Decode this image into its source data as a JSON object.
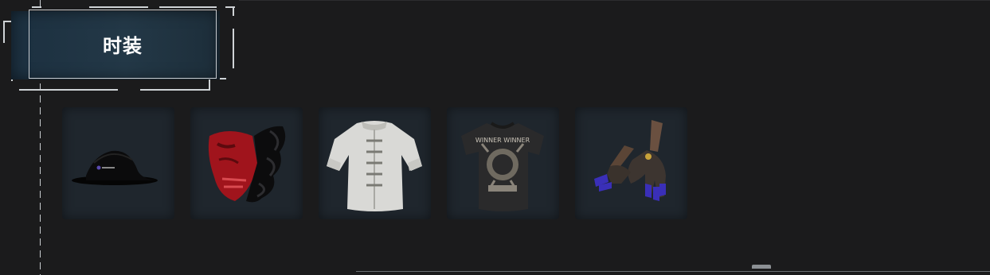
{
  "panel": {
    "title": "时装"
  },
  "items": [
    {
      "name": "hat-item",
      "icon": "hat-icon",
      "label": "hat"
    },
    {
      "name": "mask-item",
      "icon": "mask-icon",
      "label": "mask"
    },
    {
      "name": "shirt-item",
      "icon": "shirt-icon",
      "label": "shirt"
    },
    {
      "name": "tshirt-item",
      "icon": "tshirt-icon",
      "label": "t-shirt",
      "print_text": "WINNER WINNER"
    },
    {
      "name": "gloves-item",
      "icon": "gloves-icon",
      "label": "gloves"
    }
  ],
  "colors": {
    "background": "#1b1b1c",
    "title_panel": "#233847",
    "slot": "#1f262d",
    "frame_lines": "#cfd3d6"
  }
}
